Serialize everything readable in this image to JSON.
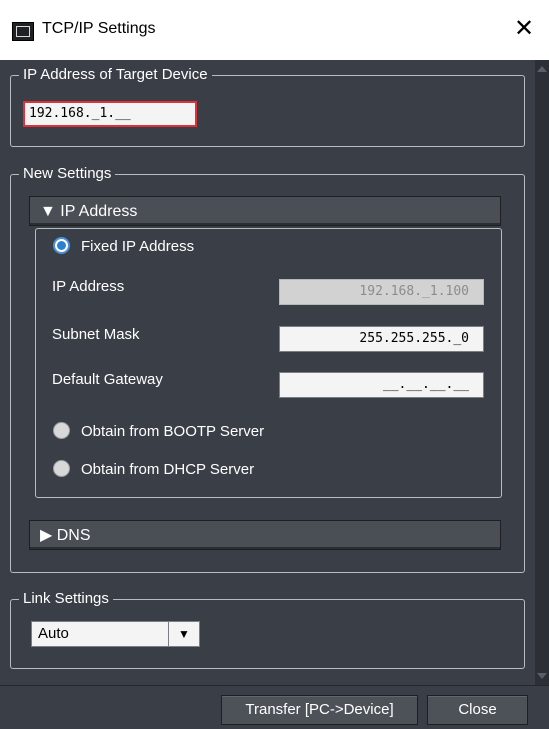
{
  "window": {
    "title": "TCP/IP Settings",
    "close_glyph": "✕"
  },
  "target": {
    "legend": "IP Address of Target Device",
    "ip_value": "192.168._1.__"
  },
  "new_settings": {
    "legend": "New Settings",
    "ip_section": {
      "header": "▼ IP Address",
      "fixed_label": "Fixed IP Address",
      "ip_label": "IP Address",
      "ip_value": "192.168._1.100",
      "subnet_label": "Subnet Mask",
      "subnet_value": "255.255.255._0",
      "gateway_label": "Default Gateway",
      "gateway_value": "__.__.__.__",
      "bootp_label": "Obtain from BOOTP Server",
      "dhcp_label": "Obtain from DHCP Server"
    },
    "dns_header": "▶ DNS"
  },
  "link": {
    "legend": "Link Settings",
    "selected": "Auto",
    "arrow": "▼"
  },
  "buttons": {
    "transfer": "Transfer [PC->Device]",
    "close": "Close"
  },
  "colors": {
    "background": "#3a3f47",
    "accent_radio": "#2f7fd0",
    "error_border": "#e0303a"
  }
}
